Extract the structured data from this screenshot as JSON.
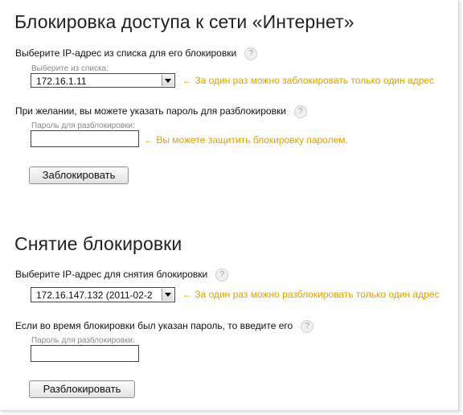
{
  "block_section": {
    "title": "Блокировка доступа к сети «Интернет»",
    "select_label": "Выберите IP-адрес из списка для его блокировки",
    "select_sublabel": "Выберите из списка:",
    "selected_ip": "172.16.1.11",
    "select_note": "← За один раз можно заблокировать только один адрес",
    "password_label": "При желании, вы можете указать пароль для разблокировки",
    "password_sublabel": "Пароль для разблокировки:",
    "password_value": "",
    "password_note": "← Вы можете защитить блокировку паролем.",
    "button_label": "Заблокировать"
  },
  "unblock_section": {
    "title": "Снятие блокировки",
    "select_label": "Выберите IP-адрес для снятия блокировки",
    "selected_ip": "172.16.147.132 (2011-02-2",
    "select_note": "← За один раз можно разблокировать только один адрес",
    "password_label": "Если во время блокировки был указан пароль, то введите его",
    "password_sublabel": "Пароль для разблокировки:",
    "password_value": "",
    "button_label": "Разблокировать"
  },
  "help_icon_text": "?",
  "colors": {
    "note": "#e0a000",
    "sublabel": "#8a8a8a"
  }
}
